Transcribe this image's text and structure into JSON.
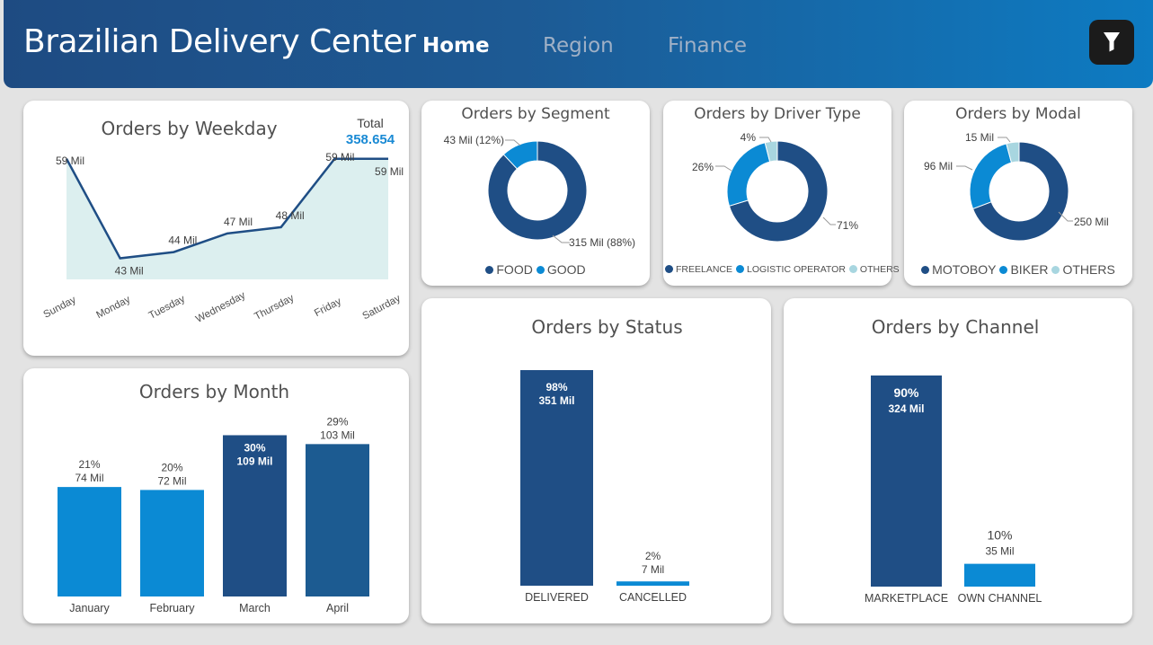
{
  "header": {
    "title": "Brazilian Delivery Center",
    "nav": [
      "Home",
      "Region",
      "Finance"
    ],
    "active_nav": "Home",
    "filter_icon": "filter-icon"
  },
  "colors": {
    "dark_blue": "#1f4e85",
    "light_blue": "#0b8ad4",
    "pale_blue": "#a8d6e0",
    "area_fill": "#dcefef"
  },
  "weekday": {
    "title": "Orders by Weekday",
    "total_label": "Total",
    "total_value": "358.654",
    "chart_data": {
      "type": "area",
      "categories": [
        "Sunday",
        "Monday",
        "Tuesday",
        "Wednesday",
        "Thursday",
        "Friday",
        "Saturday"
      ],
      "values": [
        59,
        43,
        44,
        47,
        48,
        59,
        59
      ],
      "labels": [
        "59 Mil",
        "43 Mil",
        "44 Mil",
        "47 Mil",
        "48 Mil",
        "59 Mil",
        "59 Mil"
      ],
      "ylim": [
        42.5,
        59.4
      ]
    }
  },
  "segment": {
    "title": "Orders by Segment",
    "chart_data": {
      "type": "pie",
      "categories": [
        "FOOD",
        "GOOD"
      ],
      "values": [
        315,
        43
      ],
      "labels": [
        "315 Mil (88%)",
        "43 Mil (12%)"
      ],
      "colors": [
        "#1f4e85",
        "#0b8ad4"
      ]
    }
  },
  "driver": {
    "title": "Orders by Driver Type",
    "chart_data": {
      "type": "pie",
      "categories": [
        "FREELANCE",
        "LOGISTIC OPERATOR",
        "OTHERS"
      ],
      "values": [
        71,
        26,
        4
      ],
      "labels": [
        "71%",
        "26%",
        "4%"
      ],
      "colors": [
        "#1f4e85",
        "#0b8ad4",
        "#a8d6e0"
      ]
    }
  },
  "modal": {
    "title": "Orders by Modal",
    "chart_data": {
      "type": "pie",
      "categories": [
        "MOTOBOY",
        "BIKER",
        "OTHERS"
      ],
      "values": [
        250,
        96,
        15
      ],
      "labels": [
        "250 Mil",
        "96 Mil",
        "15 Mil"
      ],
      "colors": [
        "#1f4e85",
        "#0b8ad4",
        "#a8d6e0"
      ]
    }
  },
  "month": {
    "title": "Orders by Month",
    "chart_data": {
      "type": "bar",
      "categories": [
        "January",
        "February",
        "March",
        "April"
      ],
      "values": [
        74,
        72,
        109,
        103
      ],
      "pct_labels": [
        "21%",
        "20%",
        "30%",
        "29%"
      ],
      "value_labels": [
        "74 Mil",
        "72 Mil",
        "109 Mil",
        "103 Mil"
      ],
      "colors": [
        "#0b8ad4",
        "#0b8ad4",
        "#1f4e85",
        "#1c5b91"
      ],
      "ylim": [
        0,
        119
      ]
    }
  },
  "status": {
    "title": "Orders by Status",
    "chart_data": {
      "type": "bar",
      "categories": [
        "DELIVERED",
        "CANCELLED"
      ],
      "values": [
        351,
        7
      ],
      "pct_labels": [
        "98%",
        "2%"
      ],
      "value_labels": [
        "351 Mil",
        "7 Mil"
      ],
      "colors": [
        "#1f4e85",
        "#0b8ad4"
      ],
      "ylim": [
        0,
        351
      ]
    }
  },
  "channel": {
    "title": "Orders by Channel",
    "chart_data": {
      "type": "bar",
      "categories": [
        "MARKETPLACE",
        "OWN CHANNEL"
      ],
      "values": [
        324,
        35
      ],
      "pct_labels": [
        "90%",
        "10%"
      ],
      "value_labels": [
        "324 Mil",
        "35 Mil"
      ],
      "colors": [
        "#1f4e85",
        "#0b8ad4"
      ],
      "ylim": [
        0,
        324
      ]
    }
  }
}
